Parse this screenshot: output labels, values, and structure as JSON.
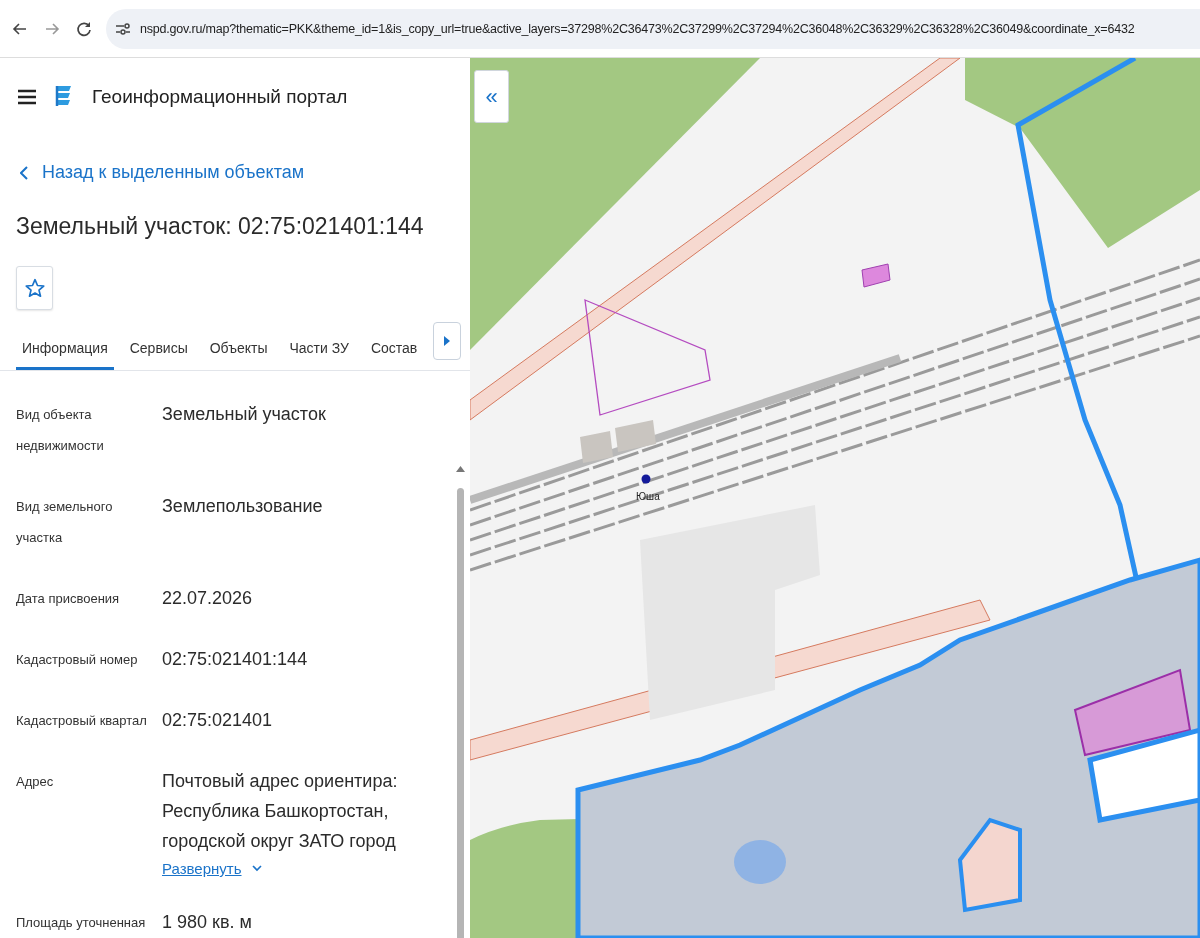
{
  "browser": {
    "url": "nspd.gov.ru/map?thematic=PKK&theme_id=1&is_copy_url=true&active_layers=37298%2C36473%2C37299%2C37294%2C36048%2C36329%2C36328%2C36049&coordinate_x=6432"
  },
  "header": {
    "title": "Геоинформационный портал"
  },
  "back_link": "Назад к выделенным объектам",
  "title": "Земельный участок: 02:75:021401:144",
  "tabs": [
    {
      "label": "Информация",
      "selected": true
    },
    {
      "label": "Сервисы",
      "selected": false
    },
    {
      "label": "Объекты",
      "selected": false
    },
    {
      "label": "Части ЗУ",
      "selected": false
    },
    {
      "label": "Состав",
      "selected": false
    }
  ],
  "details": [
    {
      "label": "Вид объекта недвижимости",
      "value": "Земельный участок"
    },
    {
      "label": "Вид земельного участка",
      "value": "Землепользование"
    },
    {
      "label": "Дата присвоения",
      "value": "22.07.2026"
    },
    {
      "label": "Кадастровый номер",
      "value": "02:75:021401:144"
    },
    {
      "label": "Кадастровый квартал",
      "value": "02:75:021401"
    },
    {
      "label": "Адрес",
      "value": "Почтовый адрес ориентира: Республика Башкортостан, городской округ ЗАТО город",
      "expand_link": "Развернуть"
    },
    {
      "label": "Площадь уточненная",
      "value": "1 980 кв. м"
    }
  ],
  "map": {
    "collapse_button": "«",
    "station_label": "Юша"
  }
}
